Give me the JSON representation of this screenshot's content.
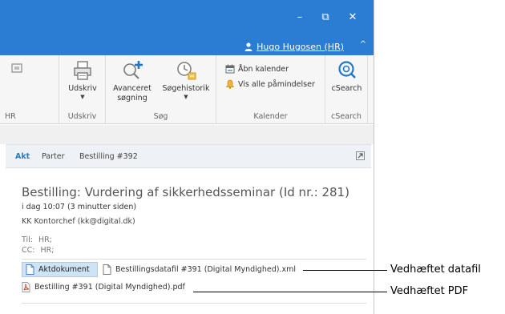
{
  "window": {
    "minimize_glyph": "–",
    "restore_glyph": "⧉",
    "close_glyph": "✕",
    "user": "Hugo Hugosen (HR)",
    "collapse_glyph": "^"
  },
  "ribbon": {
    "partial_group_label": "HR",
    "print": {
      "button": "Udskriv",
      "group_label": "Udskriv"
    },
    "search": {
      "advanced_line1": "Avanceret",
      "advanced_line2": "søgning",
      "history": "Søgehistorik",
      "group_label": "Søg"
    },
    "calendar": {
      "open": "Åbn kalender",
      "reminders": "Vis alle påmindelser",
      "group_label": "Kalender"
    },
    "csearch": {
      "button": "cSearch",
      "group_label": "cSearch"
    }
  },
  "tabs": [
    {
      "label": "Akt",
      "active": true
    },
    {
      "label": "Parter",
      "active": false
    },
    {
      "label": "Bestilling #392",
      "active": false
    }
  ],
  "message": {
    "subject": "Bestilling: Vurdering af sikkerhedsseminar (Id nr.: 281)",
    "time": "i dag 10:07 (3 minutter siden)",
    "sender": "KK Kontorchef (kk@digital.dk)",
    "to_label": "Til:",
    "to_value": "HR;",
    "cc_label": "CC:",
    "cc_value": "HR;"
  },
  "attachments": {
    "main_document": "Aktdokument",
    "datafile": "Bestillingsdatafil #391 (Digital Myndighed).xml",
    "pdf": "Bestilling #391 (Digital Myndighed).pdf"
  },
  "callouts": {
    "datafile": "Vedhæftet datafil",
    "pdf": "Vedhæftet PDF"
  },
  "colors": {
    "titlebar": "#2b7cd3",
    "accent": "#2b79c8",
    "selected_attachment": "#cfe3f7",
    "pdf_icon": "#d83b2e"
  }
}
